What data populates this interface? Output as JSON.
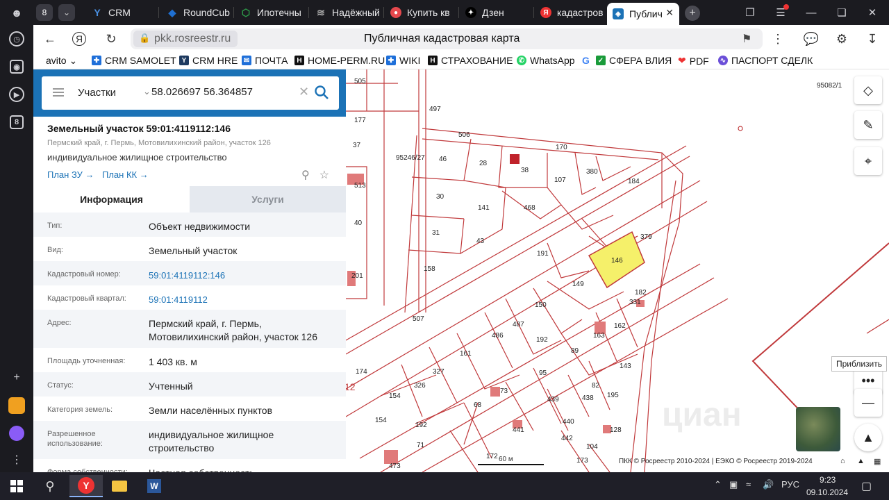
{
  "tabs": [
    {
      "label": "CRM",
      "fav_color": "#2a6bd8",
      "fav": "Y"
    },
    {
      "label": "RoundCub",
      "fav_color": "#1f6fd1",
      "fav": "◆"
    },
    {
      "label": "Ипотечны",
      "fav_color": "#2e9e4a",
      "fav": "⬡"
    },
    {
      "label": "Надёжный",
      "fav_color": "#777",
      "fav": "≋"
    },
    {
      "label": "Купить кв",
      "fav_color": "#e5484d",
      "fav": "●"
    },
    {
      "label": "Дзен",
      "fav_color": "#111",
      "fav": "✦"
    },
    {
      "label": "кадастров",
      "fav_color": "#e33",
      "fav": "Я"
    },
    {
      "label": "Публич",
      "fav_color": "#1b72b6",
      "fav": "◈"
    }
  ],
  "tab_group_count": "8",
  "sidebar_badge": "8",
  "address": {
    "url": "pkk.rosreestr.ru",
    "title": "Публичная кадастровая карта"
  },
  "bookmarks": [
    {
      "label": "avito ⌄",
      "icon": "",
      "color": "#fff"
    },
    {
      "label": "CRM SAMOLET",
      "icon": "✚",
      "color": "#1e6fd9"
    },
    {
      "label": "CRM HRE",
      "icon": "Y",
      "color": "#1e3a5f"
    },
    {
      "label": "ПОЧТА",
      "icon": "✉",
      "color": "#1e6fd9"
    },
    {
      "label": "HOME-PERM.RU",
      "icon": "H",
      "color": "#111"
    },
    {
      "label": "WIKI",
      "icon": "✚",
      "color": "#1e6fd9"
    },
    {
      "label": "СТРАХОВАНИЕ",
      "icon": "H",
      "color": "#111"
    },
    {
      "label": "WhatsApp",
      "icon": "✆",
      "color": "#25d366"
    },
    {
      "label": "G",
      "icon": "",
      "color": "#fff"
    },
    {
      "label": "СФЕРА ВЛИЯ",
      "icon": "✓",
      "color": "#1a9b3a"
    },
    {
      "label": "PDF",
      "icon": "❤",
      "color": "#e33"
    },
    {
      "label": "ПАСПОРТ СДЕЛК",
      "icon": "∿",
      "color": "#6b4fd8"
    }
  ],
  "search": {
    "type": "Участки",
    "value": "58.026697 56.364857"
  },
  "object": {
    "title": "Земельный участок 59:01:4119112:146",
    "address_short": "Пермский край, г. Пермь, Мотовилихинский район, участок 126",
    "use": "индивидуальное жилищное строительство",
    "plan_zu": "План ЗУ →",
    "plan_kk": "План КК →"
  },
  "panel_tabs": {
    "info": "Информация",
    "services": "Услуги"
  },
  "properties": [
    {
      "label": "Тип:",
      "value": "Объект недвижимости",
      "link": false
    },
    {
      "label": "Вид:",
      "value": "Земельный участок",
      "link": false
    },
    {
      "label": "Кадастровый номер:",
      "value": "59:01:4119112:146",
      "link": true
    },
    {
      "label": "Кадастровый квартал:",
      "value": "59:01:4119112",
      "link": true
    },
    {
      "label": "Адрес:",
      "value": "Пермский край, г. Пермь, Мотовилихинский район, участок 126",
      "link": false
    },
    {
      "label": "Площадь уточненная:",
      "value": "1 403 кв. м",
      "link": false
    },
    {
      "label": "Статус:",
      "value": "Учтенный",
      "link": false
    },
    {
      "label": "Категория земель:",
      "value": "Земли населённых пунктов",
      "link": false
    },
    {
      "label": "Разрешенное использование:",
      "value": "индивидуальное жилищное строительство",
      "link": false
    },
    {
      "label": "Форма собственности:",
      "value": "Частная собственность",
      "link": false
    }
  ],
  "map": {
    "parcel_labels": [
      "505",
      "177",
      "497",
      "506",
      "170",
      "95082/1",
      "37",
      "46",
      "28",
      "38",
      "380",
      "95246/27",
      "107",
      "184",
      "513",
      "30",
      "141",
      "468",
      "40",
      "31",
      "43",
      "379",
      "158",
      "191",
      "146",
      "201",
      "149",
      "182",
      "331",
      "150",
      "507",
      "487",
      "486",
      "162",
      "192",
      "163",
      "161",
      "89",
      "143",
      "174",
      "327",
      "95",
      "12",
      "326",
      "73",
      "438",
      "82",
      "154",
      "439",
      "195",
      "68",
      "441",
      "440",
      "154",
      "192",
      "442",
      "71",
      "128",
      "172",
      "173",
      "104",
      "473"
    ],
    "scale_label": "60 м",
    "copyright": "ПКК © Росреестр 2010-2024 | ЕЭКО © Росреестр 2019-2024",
    "tooltip": "Приблизить",
    "watermark": "циан"
  },
  "taskbar": {
    "lang": "РУС",
    "time": "9:23",
    "date": "09.10.2024"
  },
  "colors": {
    "accent": "#1b72b6",
    "parcel_line": "#c0393b",
    "selected_parcel": "#f5f06a"
  }
}
